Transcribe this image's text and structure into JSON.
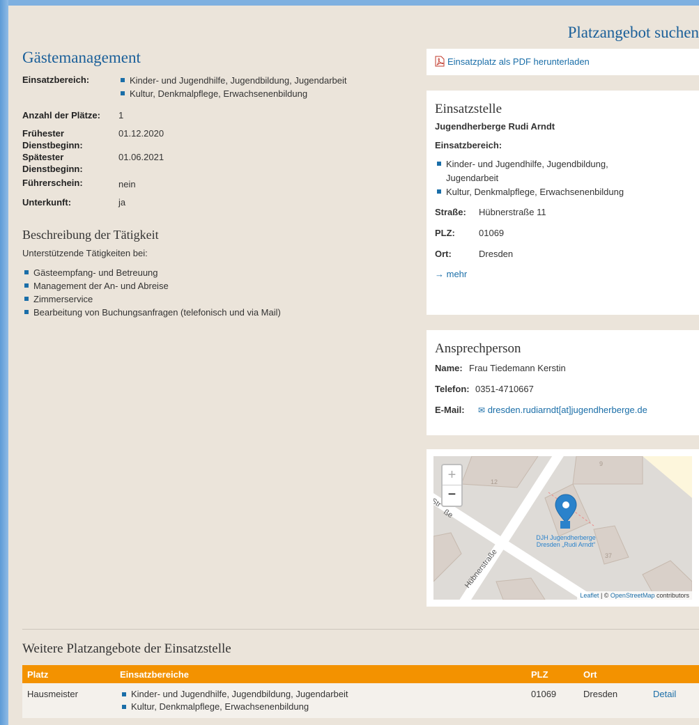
{
  "header": {
    "search_link": "Platzangebot suchen"
  },
  "main": {
    "title": "Gästemanagement",
    "details": [
      {
        "label": "Einsatzbereich:",
        "values": [
          "Kinder- und Jugendhilfe, Jugendbildung, Jugendarbeit",
          "Kultur, Denkmalpflege, Erwachsenenbildung"
        ]
      },
      {
        "label": "Anzahl der Plätze:",
        "value": "1"
      },
      {
        "label": "Frühester Dienstbeginn:",
        "value": "01.12.2020"
      },
      {
        "label": "Spätester Dienstbeginn:",
        "value": "01.06.2021"
      },
      {
        "label": "Führerschein:",
        "value": "nein"
      },
      {
        "label": "Unterkunft:",
        "value": "ja"
      }
    ],
    "description": {
      "heading": "Beschreibung der Tätigkeit",
      "intro": "Unterstützende Tätigkeiten bei:",
      "items": [
        "Gästeempfang- und Betreuung",
        "Management der An- und Abreise",
        "Zimmerservice",
        "Bearbeitung von Buchungsanfragen (telefonisch und via Mail)"
      ]
    }
  },
  "sidebar": {
    "pdf_link": "Einsatzplatz als PDF herunterladen",
    "einsatzstelle": {
      "heading": "Einsatzstelle",
      "name": "Jugendherberge Rudi Arndt",
      "bereich_label": "Einsatzbereich:",
      "bereiche": [
        "Kinder- und Jugendhilfe, Jugendbildung, Jugendarbeit",
        "Kultur, Denkmalpflege, Erwachsenenbildung"
      ],
      "strasse_label": "Straße:",
      "strasse": "Hübnerstraße 11",
      "plz_label": "PLZ:",
      "plz": "01069",
      "ort_label": "Ort:",
      "ort": "Dresden",
      "mehr": "→ mehr"
    },
    "contact": {
      "heading": "Ansprechperson",
      "name_label": "Name:",
      "name": "Frau Tiedemann Kerstin",
      "phone_label": "Telefon:",
      "phone": "0351-4710667",
      "email_label": "E-Mail:",
      "email": "dresden.rudiarndt[at]jugendherberge.de"
    },
    "map": {
      "zoom_in": "+",
      "zoom_out": "−",
      "street_main": "Hübnerstraße",
      "street_partial": "Str",
      "street_partial2": "ße",
      "poi_label": "DJH Jugendherberge Dresden „Rudi Arndt“",
      "numbers": [
        "12",
        "9",
        "37"
      ],
      "attribution_leaflet": "Leaflet",
      "attribution_sep": " | © ",
      "attribution_osm": "OpenStreetMap",
      "attribution_tail": " contributors"
    }
  },
  "more_offers": {
    "heading": "Weitere Platzangebote der Einsatzstelle",
    "columns": [
      "Platz",
      "Einsatzbereiche",
      "PLZ",
      "Ort",
      ""
    ],
    "rows": [
      {
        "platz": "Hausmeister",
        "bereiche": [
          "Kinder- und Jugendhilfe, Jugendbildung, Jugendarbeit",
          "Kultur, Denkmalpflege, Erwachsenenbildung"
        ],
        "plz": "01069",
        "ort": "Dresden",
        "detail": "Detail"
      }
    ]
  },
  "colors": {
    "accent": "#1a5f99",
    "table_header": "#f39200",
    "page_bg": "#ebe4da"
  }
}
